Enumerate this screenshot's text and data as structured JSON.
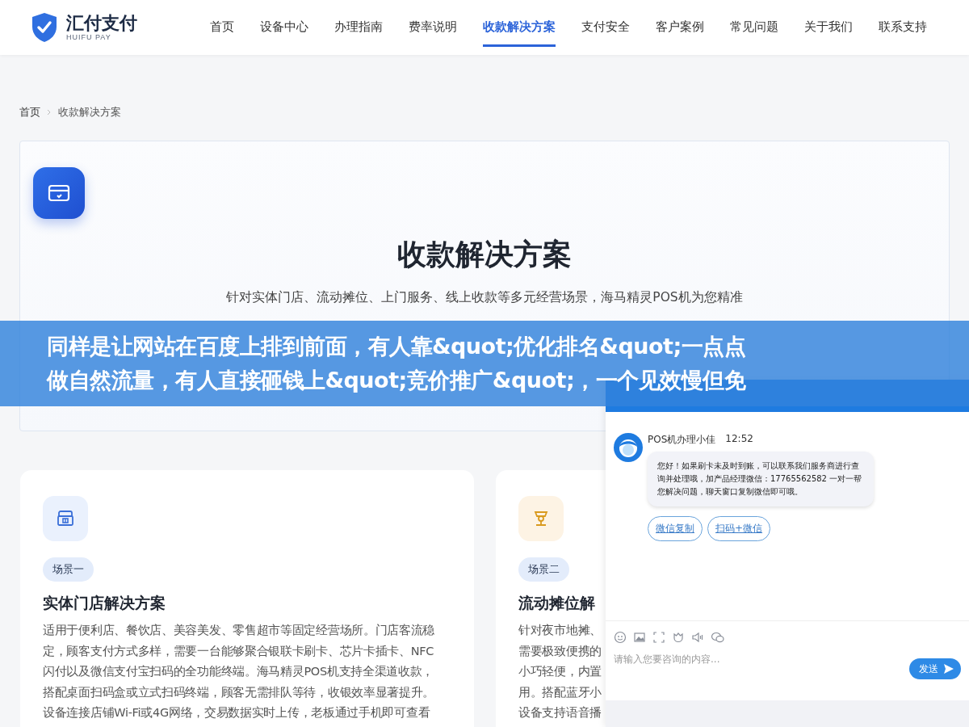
{
  "header": {
    "logo": {
      "name": "汇付支付",
      "subtitle": "HUIFU PAY"
    },
    "nav": [
      {
        "label": "首页",
        "selected": false
      },
      {
        "label": "设备中心",
        "selected": false
      },
      {
        "label": "办理指南",
        "selected": false
      },
      {
        "label": "费率说明",
        "selected": false
      },
      {
        "label": "收款解决方案",
        "selected": true
      },
      {
        "label": "支付安全",
        "selected": false
      },
      {
        "label": "客户案例",
        "selected": false
      },
      {
        "label": "常见问题",
        "selected": false
      },
      {
        "label": "关于我们",
        "selected": false
      },
      {
        "label": "联系支持",
        "selected": false
      }
    ]
  },
  "breadcrumb": [
    "首页",
    "收款解决方案"
  ],
  "hero": {
    "title": "收款解决方案",
    "description": "针对实体门店、流动摊位、上门服务、线上收款等多元经营场景，海马精灵POS机为您精准"
  },
  "cards": [
    {
      "kind": "store",
      "tag": "场景一",
      "title": "实体门店解决方案",
      "lines": [
        "适用于便利店、餐饮店、美容美发、零售超市等固定经营场所。门店客流稳",
        "定，顾客支付方式多样，需要一台能够聚合银联卡刷卡、芯片卡插卡、NFC",
        "闪付以及微信支付宝扫码的全功能终端。海马精灵POS机支持全渠道收款，",
        "搭配桌面扫码盒或立式扫码终端，顾客无需排队等待，收银效率显著提升。",
        "设备连接店铺Wi-Fi或4G网络，交易数据实时上传，老板通过手机即可查看"
      ]
    },
    {
      "kind": "stall",
      "tag": "场景二",
      "title": "流动摊位解",
      "lines": [
        "针对夜市地摊、",
        "需要极致便携的",
        "小巧轻便，内置",
        "用。搭配蓝牙小",
        "设备支持语音播"
      ]
    }
  ],
  "banner": {
    "lines": [
      "同样是让网站在百度上排到前面，有人靠&quot;优化排名&quot;一点点",
      "做自然流量，有人直接砸钱上&quot;竞价推广&quot;，一个见效慢但免"
    ]
  },
  "chat": {
    "messages": [
      {
        "sender": "POS机办理小佳",
        "time": "12:52",
        "text": "您好！如果刷卡未及时到账，可以联系我们服务商进行查询并处理哦，加产品经理微信：17765562582 一对一帮您解决问题，聊天窗口复制微信即可哦。"
      }
    ],
    "quick_replies": [
      "微信复制",
      "扫码+微信"
    ],
    "input": {
      "placeholder": "请输入您要咨询的内容..."
    },
    "send": "发送"
  }
}
